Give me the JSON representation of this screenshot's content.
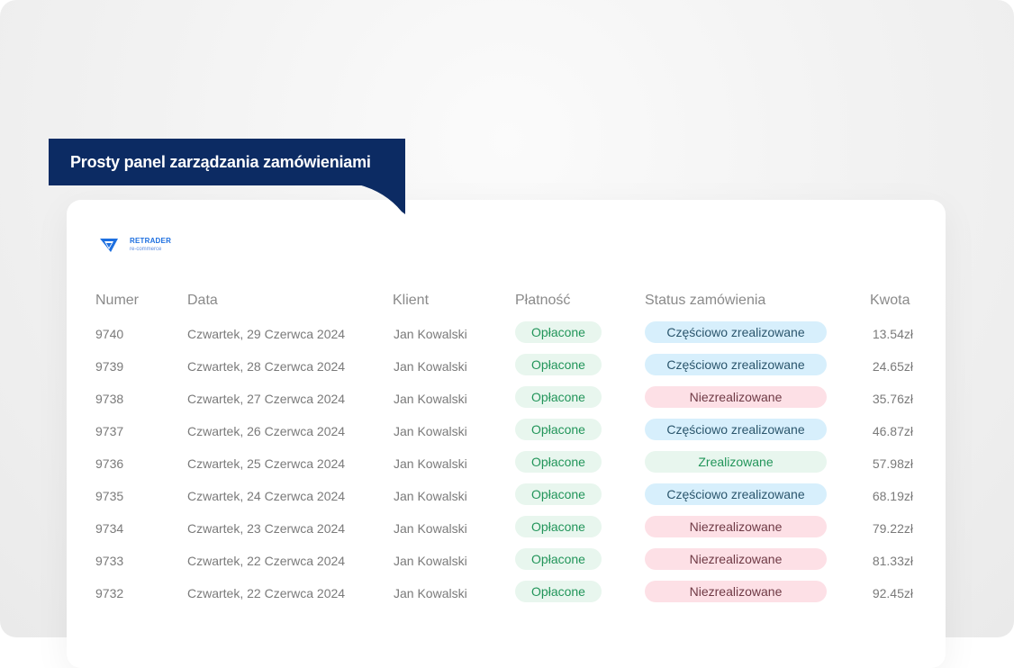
{
  "banner": {
    "title": "Prosty panel zarządzania zamówieniami"
  },
  "logo": {
    "name": "RETRADER",
    "sub": "re-commerce"
  },
  "table": {
    "headers": {
      "number": "Numer",
      "date": "Data",
      "client": "Klient",
      "payment": "Płatność",
      "status": "Status zamówienia",
      "amount": "Kwota"
    },
    "rows": [
      {
        "number": "9740",
        "date": "Czwartek, 29 Czerwca 2024",
        "client": "Jan Kowalski",
        "payment": "Opłacone",
        "status": "Częściowo zrealizowane",
        "status_type": "partial",
        "amount": "13.54zł"
      },
      {
        "number": "9739",
        "date": "Czwartek, 28 Czerwca 2024",
        "client": "Jan Kowalski",
        "payment": "Opłacone",
        "status": "Częściowo zrealizowane",
        "status_type": "partial",
        "amount": "24.65zł"
      },
      {
        "number": "9738",
        "date": "Czwartek, 27 Czerwca 2024",
        "client": "Jan Kowalski",
        "payment": "Opłacone",
        "status": "Niezrealizowane",
        "status_type": "none",
        "amount": "35.76zł"
      },
      {
        "number": "9737",
        "date": "Czwartek, 26 Czerwca 2024",
        "client": "Jan Kowalski",
        "payment": "Opłacone",
        "status": "Częściowo zrealizowane",
        "status_type": "partial",
        "amount": "46.87zł"
      },
      {
        "number": "9736",
        "date": "Czwartek, 25 Czerwca 2024",
        "client": "Jan Kowalski",
        "payment": "Opłacone",
        "status": "Zrealizowane",
        "status_type": "done",
        "amount": "57.98zł"
      },
      {
        "number": "9735",
        "date": "Czwartek, 24 Czerwca 2024",
        "client": "Jan Kowalski",
        "payment": "Opłacone",
        "status": "Częściowo zrealizowane",
        "status_type": "partial",
        "amount": "68.19zł"
      },
      {
        "number": "9734",
        "date": "Czwartek, 23 Czerwca 2024",
        "client": "Jan Kowalski",
        "payment": "Opłacone",
        "status": "Niezrealizowane",
        "status_type": "none",
        "amount": "79.22zł"
      },
      {
        "number": "9733",
        "date": "Czwartek, 22 Czerwca 2024",
        "client": "Jan Kowalski",
        "payment": "Opłacone",
        "status": "Niezrealizowane",
        "status_type": "none",
        "amount": "81.33zł"
      },
      {
        "number": "9732",
        "date": "Czwartek, 22 Czerwca 2024",
        "client": "Jan Kowalski",
        "payment": "Opłacone",
        "status": "Niezrealizowane",
        "status_type": "none",
        "amount": "92.45zł"
      }
    ]
  },
  "colors": {
    "banner_bg": "#0c2b63",
    "brand_blue": "#1d6fe0",
    "paid_green": "#22955a",
    "status_partial_bg": "#d7effc",
    "status_none_bg": "#fde0e6",
    "status_done_bg": "#e8f6ee"
  }
}
